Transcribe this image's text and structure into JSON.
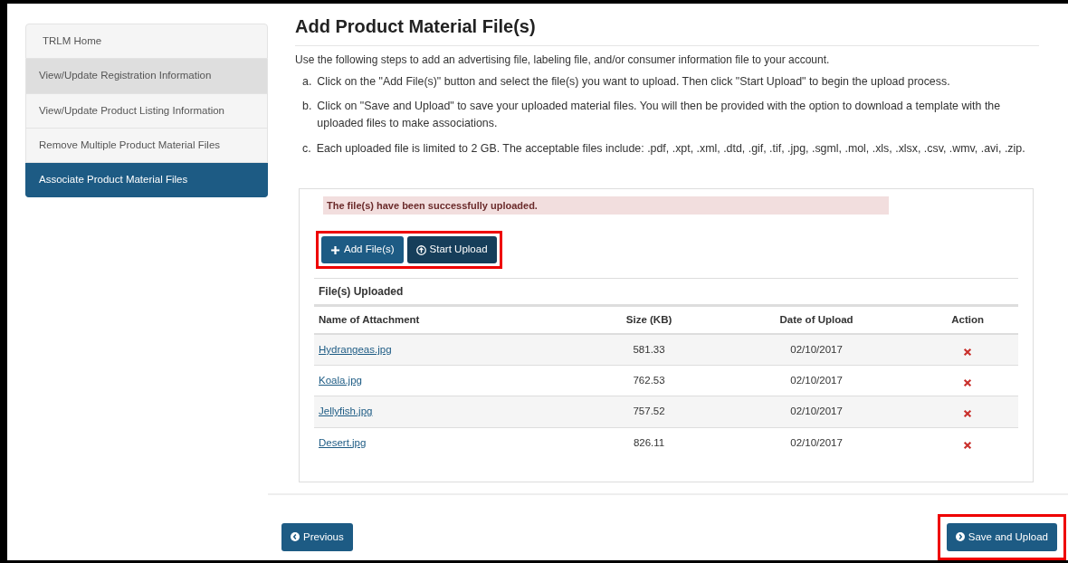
{
  "sidebar": {
    "items": [
      {
        "label": "TRLM Home",
        "selected": false,
        "hovered": false
      },
      {
        "label": "View/Update Registration Information",
        "selected": false,
        "hovered": true
      },
      {
        "label": "View/Update Product Listing Information",
        "selected": false,
        "hovered": false
      },
      {
        "label": "Remove Multiple Product Material Files",
        "selected": false,
        "hovered": false
      },
      {
        "label": "Associate Product Material Files",
        "selected": true,
        "hovered": false
      }
    ]
  },
  "page_title": "Add Product Material File(s)",
  "intro": "Use the following steps to add an advertising file, labeling file, and/or consumer information file to your account.",
  "steps": [
    {
      "marker": "a.",
      "text": "Click on the \"Add File(s)\" button and select the file(s) you want to upload. Then click \"Start Upload\" to begin the upload process."
    },
    {
      "marker": "b.",
      "text": "Click on \"Save and Upload\" to save your uploaded material files. You will then be provided with the option to download a template with the uploaded files to make associations."
    },
    {
      "marker": "c.",
      "text": "Each uploaded file is limited to 2 GB. The acceptable files include: .pdf, .xpt, .xml, .dtd, .gif, .tif, .jpg, .sgml, .mol, .xls, .xlsx, .csv, .wmv, .avi, .zip."
    }
  ],
  "upload_panel": {
    "alert": "The file(s) have been successfully uploaded.",
    "buttons_highlighted": true,
    "buttons": [
      {
        "label": "Add File(s)",
        "kind": "add"
      },
      {
        "label": "Start Upload",
        "kind": "upload"
      }
    ],
    "table": {
      "caption": "File(s) Uploaded",
      "columns": [
        "Name of Attachment",
        "Size (KB)",
        "Date of Upload",
        "Action"
      ],
      "rows": [
        {
          "name": "Hydrangeas.jpg",
          "size": "581.33",
          "date": "02/10/2017"
        },
        {
          "name": "Koala.jpg",
          "size": "762.53",
          "date": "02/10/2017"
        },
        {
          "name": "Jellyfish.jpg",
          "size": "757.52",
          "date": "02/10/2017"
        },
        {
          "name": "Desert.jpg",
          "size": "826.11",
          "date": "02/10/2017"
        }
      ]
    }
  },
  "footer": {
    "previous": {
      "label": "Previous"
    },
    "save": {
      "label": "Save and Upload",
      "highlighted": true
    }
  }
}
